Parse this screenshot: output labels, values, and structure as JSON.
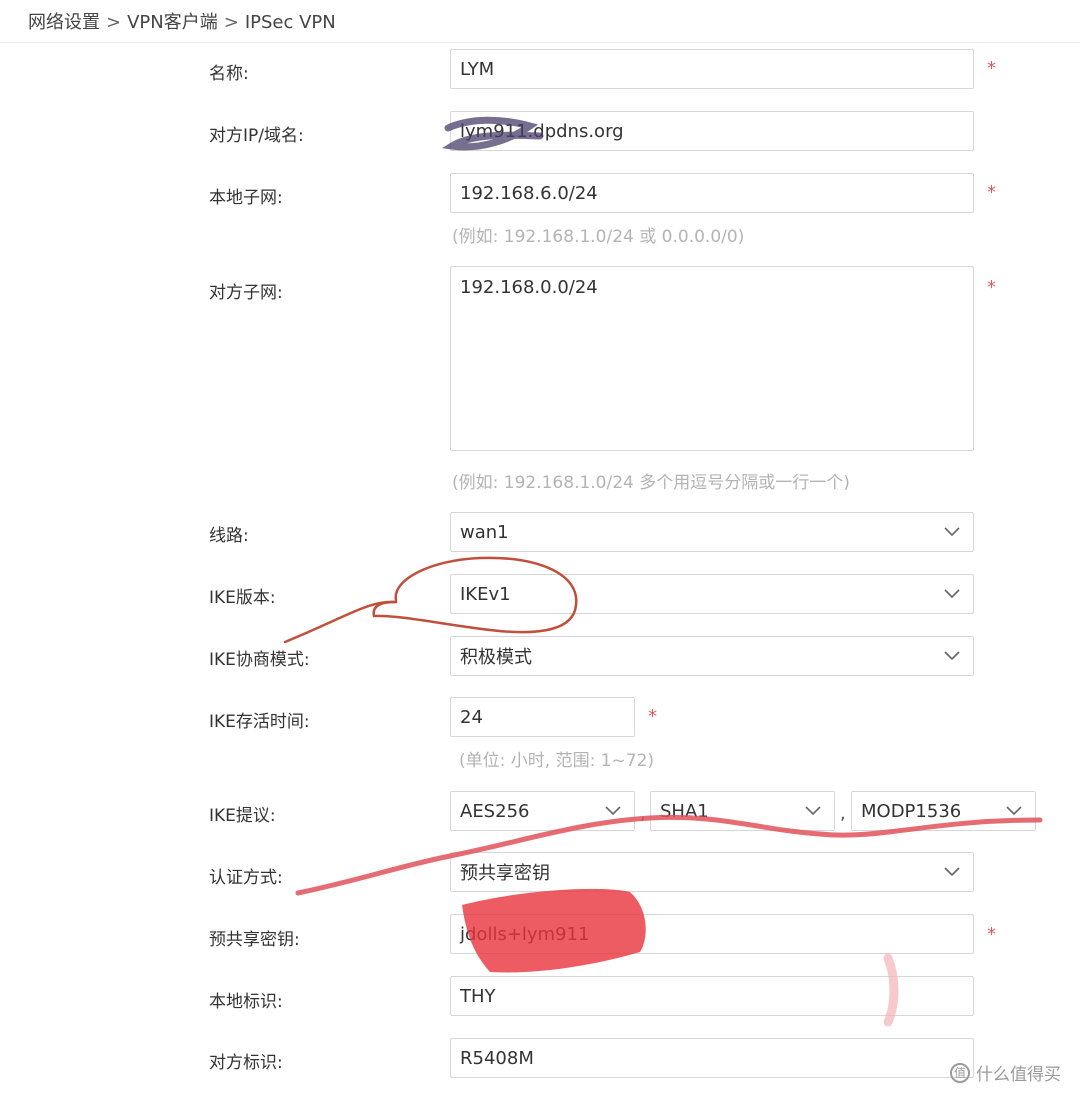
{
  "breadcrumb": {
    "items": [
      "网络设置",
      "VPN客户端",
      "IPSec VPN"
    ],
    "separator": ">"
  },
  "form": {
    "name": {
      "label": "名称:",
      "value": "LYM",
      "required": "*"
    },
    "peer": {
      "label": "对方IP/域名:",
      "value": "lym911.dpdns.org"
    },
    "local_subnet": {
      "label": "本地子网:",
      "value": "192.168.6.0/24",
      "required": "*",
      "hint": "(例如: 192.168.1.0/24 或 0.0.0.0/0)"
    },
    "peer_subnet": {
      "label": "对方子网:",
      "value": "192.168.0.0/24",
      "required": "*",
      "hint": "(例如: 192.168.1.0/24 多个用逗号分隔或一行一个)"
    },
    "line": {
      "label": "线路:",
      "value": "wan1"
    },
    "ike_version": {
      "label": "IKE版本:",
      "value": "IKEv1"
    },
    "ike_mode": {
      "label": "IKE协商模式:",
      "value": "积极模式"
    },
    "ike_lifetime": {
      "label": "IKE存活时间:",
      "value": "24",
      "required": "*",
      "hint": "(单位: 小时, 范围: 1~72)"
    },
    "ike_proposal": {
      "label": "IKE提议:",
      "encryption": "AES256",
      "hash": "SHA1",
      "dh_group": "MODP1536",
      "comma": ","
    },
    "auth_method": {
      "label": "认证方式:",
      "value": "预共享密钥"
    },
    "psk": {
      "label": "预共享密钥:",
      "value": "jdolls+lym911",
      "required": "*"
    },
    "local_id": {
      "label": "本地标识:",
      "value": "THY"
    },
    "peer_id": {
      "label": "对方标识:",
      "value": "R5408M"
    }
  },
  "watermark": {
    "text": "什么值得买",
    "icon_glyph": "值"
  },
  "icons": {
    "dropdown": "chevron-down-icon"
  },
  "colors": {
    "required": "#e05a5a",
    "hint": "#b4b4b4",
    "annotation": "#c0503c",
    "scribble_red": "#e8323c",
    "scribble_purple": "#4a3f6b"
  }
}
